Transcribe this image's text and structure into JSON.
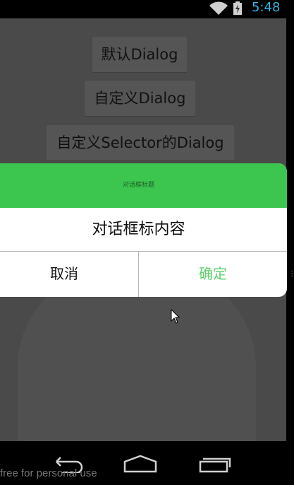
{
  "status_bar": {
    "time": "5:48",
    "wifi_icon": "wifi-icon",
    "battery_icon": "battery-charging-icon"
  },
  "buttons": {
    "default_dialog": "默认Dialog",
    "custom_dialog": "自定义Dialog",
    "selector_dialog": "自定义Selector的Dialog"
  },
  "dialog": {
    "title": "对话框标题",
    "content": "对话框标内容",
    "cancel": "取消",
    "confirm": "确定"
  },
  "colors": {
    "title_bar": "#3cc64f",
    "confirm_text": "#5fd26d",
    "status_clock": "#33b5e5"
  },
  "nav_bar": {
    "back_icon": "back-icon",
    "home_icon": "home-icon",
    "recents_icon": "recents-icon"
  },
  "watermark": "free for personal use"
}
